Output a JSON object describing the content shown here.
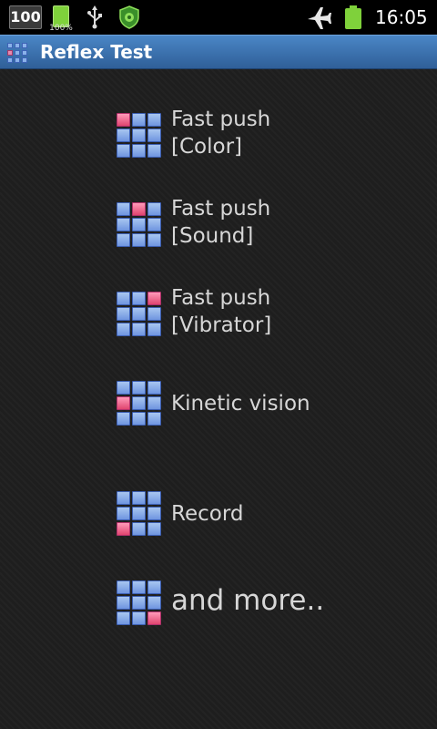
{
  "status_bar": {
    "battery_number": "100",
    "small_battery_percent": "100%",
    "time": "16:05",
    "icons": [
      "battery-number-icon",
      "small-battery-icon",
      "usb-icon",
      "shield-icon",
      "airplane-icon",
      "battery-full-icon"
    ]
  },
  "title_bar": {
    "title": "Reflex Test",
    "icon": "app-grid-icon"
  },
  "menu": [
    {
      "line1": "Fast push",
      "line2": "[Color]",
      "highlight_cell": 0
    },
    {
      "line1": "Fast push",
      "line2": "[Sound]",
      "highlight_cell": 1
    },
    {
      "line1": "Fast push",
      "line2": "[Vibrator]",
      "highlight_cell": 2
    },
    {
      "line1": "Kinetic vision",
      "line2": "",
      "highlight_cell": 3
    },
    {
      "line1": "Record",
      "line2": "",
      "highlight_cell": 6
    },
    {
      "line1": "and more..",
      "line2": "",
      "highlight_cell": 8
    }
  ],
  "colors": {
    "titlebar_top": "#4a86c6",
    "titlebar_bottom": "#2f5f98",
    "cell_blue": "#8ab2ea",
    "cell_pink": "#f0628f",
    "battery_green": "#7fd13b"
  }
}
